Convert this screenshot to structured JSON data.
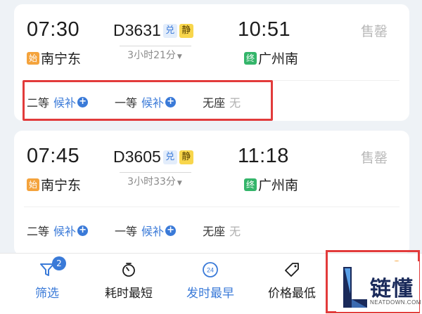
{
  "trains": [
    {
      "dep_time": "07:30",
      "arr_time": "10:51",
      "train_no": "D3631",
      "tags": [
        "兑",
        "静"
      ],
      "duration": "3小时21分",
      "dep_badge": "始",
      "dep_station": "南宁东",
      "arr_badge": "终",
      "arr_station": "广州南",
      "status": "售罄",
      "seats": [
        {
          "class": "二等",
          "avail": "候补",
          "waitlist": true
        },
        {
          "class": "一等",
          "avail": "候补",
          "waitlist": true
        },
        {
          "class": "无座",
          "avail": "无",
          "waitlist": false
        }
      ]
    },
    {
      "dep_time": "07:45",
      "arr_time": "11:18",
      "train_no": "D3605",
      "tags": [
        "兑",
        "静"
      ],
      "duration": "3小时33分",
      "dep_badge": "始",
      "dep_station": "南宁东",
      "arr_badge": "终",
      "arr_station": "广州南",
      "status": "售罄",
      "seats": [
        {
          "class": "二等",
          "avail": "候补",
          "waitlist": true
        },
        {
          "class": "一等",
          "avail": "候补",
          "waitlist": true
        },
        {
          "class": "无座",
          "avail": "无",
          "waitlist": false
        }
      ]
    }
  ],
  "toolbar": {
    "filter_label": "筛选",
    "filter_count": "2",
    "fastest_label": "耗时最短",
    "earliest_label": "发时最早",
    "earliest_icon_text": "24",
    "price_label": "价格最低",
    "extra_count": "2"
  },
  "watermark": {
    "text": "链懂",
    "sub": "NEATDOWN.COM"
  },
  "colors": {
    "accent": "#3a7ad8",
    "highlight": "#e23b3b",
    "start_badge": "#f4a33c",
    "end_badge": "#34b56a",
    "silent_tag": "#f8d64c"
  }
}
